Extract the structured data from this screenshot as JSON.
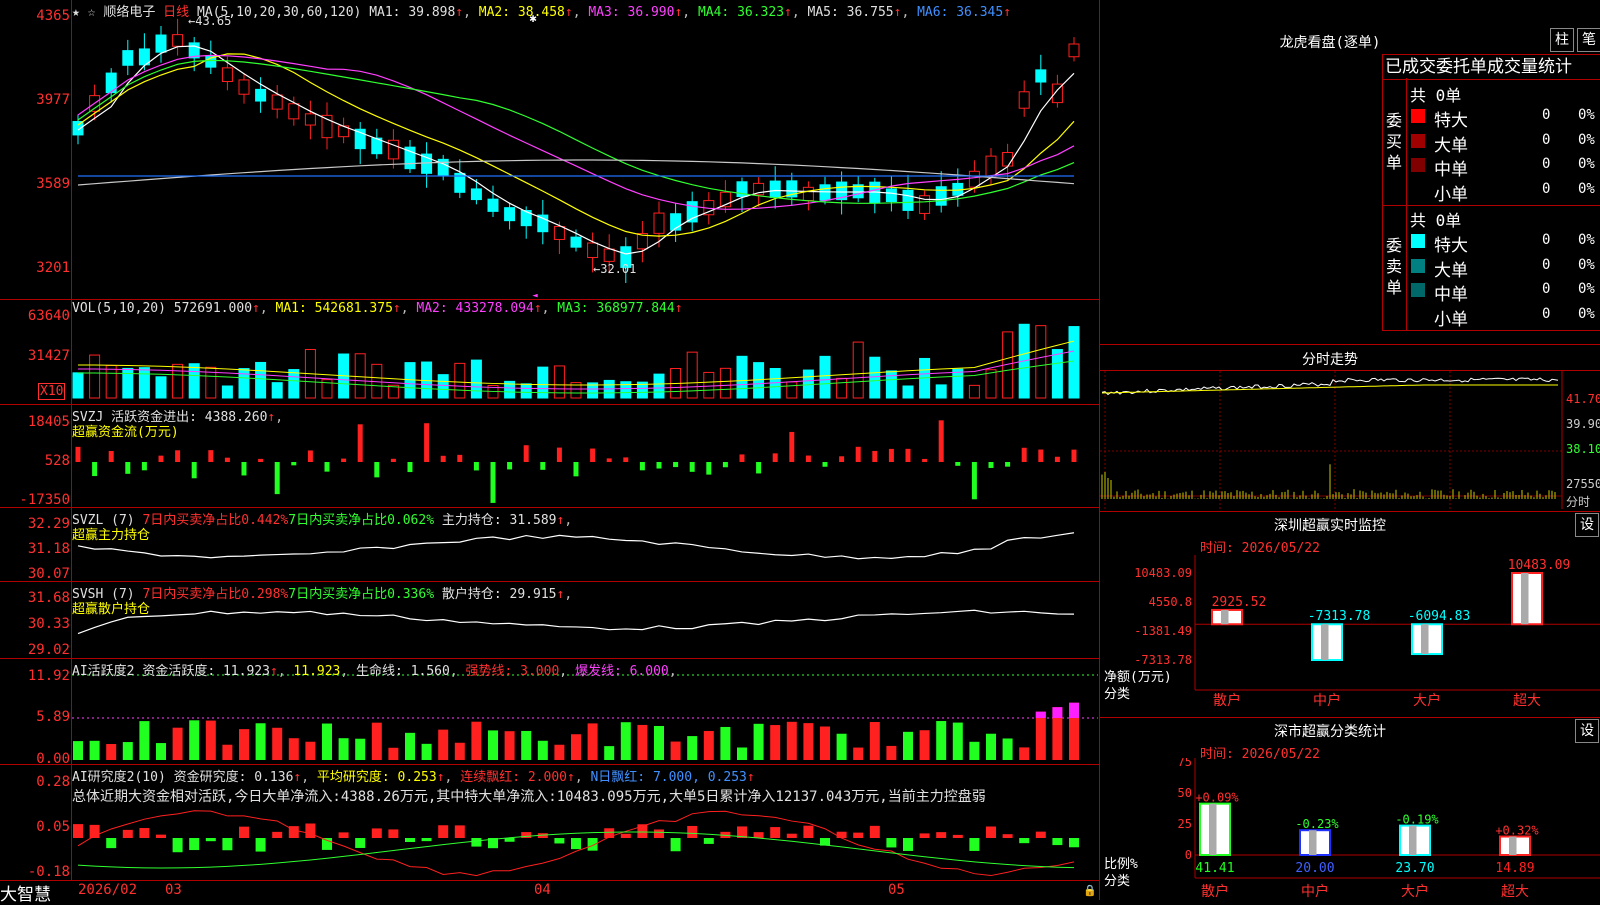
{
  "stock_name": "顺络电子",
  "period_label": "日线",
  "price_panel": {
    "ma_params": "MA(5,10,20,30,60,120)",
    "ma1": "MA1: 39.898",
    "ma2": "MA2: 38.458",
    "ma3": "MA3: 36.990",
    "ma4": "MA4: 36.323",
    "ma5": "MA5: 36.755",
    "ma6": "MA6: 36.345",
    "high_mark": "43.65",
    "low_mark": "32.01",
    "axis": [
      "4365",
      "3977",
      "3589",
      "3201"
    ]
  },
  "vol_panel": {
    "label": "VOL(5,10,20)",
    "value": "572691.000",
    "ma1": "MA1: 542681.375",
    "ma2": "MA2: 433278.094",
    "ma3": "MA3: 368977.844",
    "axis": [
      "63640",
      "31427"
    ],
    "unit": "X10"
  },
  "svzj_panel": {
    "label": "SVZJ",
    "title": "活跃资金进出: 4388.260",
    "subtitle": "超赢资金流(万元)",
    "axis": [
      "18405",
      "528",
      "-17350"
    ]
  },
  "svzl_panel": {
    "label": "SVZL (7)",
    "t1": "7日内买卖净占比0.442%",
    "t2": "7日内买卖净占比0.062%",
    "t3": "主力持仓: 31.589",
    "subtitle": "超赢主力持仓",
    "axis": [
      "32.29",
      "31.18",
      "30.07"
    ]
  },
  "svsh_panel": {
    "label": "SVSH (7)",
    "t1": "7日内买卖净占比0.298%",
    "t2": "7日内买卖净占比0.336%",
    "t3": "散户持仓: 29.915",
    "subtitle": "超赢散户持仓",
    "axis": [
      "31.68",
      "30.33",
      "29.02"
    ]
  },
  "ai_active_panel": {
    "label": "AI活跃度2",
    "t1": "资金活跃度: 11.923",
    "t2": "11.923",
    "t3": "生命线: 1.560",
    "t4": "强势线: 3.000",
    "t5": "爆发线: 6.000",
    "axis": [
      "11.92",
      "5.89",
      "0.00"
    ]
  },
  "ai_research_panel": {
    "label": "AI研究度2(10)",
    "t1": "资金研究度: 0.136",
    "t2": "平均研究度: 0.253",
    "t3": "连续飘红: 2.000",
    "t4": "N日飘红: 7.000, 0.253",
    "summary": "总体近期大资金相对活跃,今日大单净流入:4388.26万元,其中特大单净流入:10483.095万元,大单5日累计净入12137.043万元,当前主力控盘弱",
    "axis": [
      "0.28",
      "0.05",
      "-0.18"
    ]
  },
  "bottom_axis": {
    "brand": "大智慧",
    "labels": [
      "2026/02",
      "03",
      "04",
      "05"
    ]
  },
  "dragon_tiger": {
    "title": "龙虎看盘(逐单)",
    "btn1": "柱",
    "btn2": "笔",
    "header": "已成交委托单成交量统计",
    "buy_label": "委买单",
    "sell_label": "委卖单",
    "buy_total": "共 0单",
    "sell_total": "共 0单",
    "rows": [
      {
        "name": "特大",
        "count": "0",
        "pct": "0%"
      },
      {
        "name": "大单",
        "count": "0",
        "pct": "0%"
      },
      {
        "name": "中单",
        "count": "0",
        "pct": "0%"
      },
      {
        "name": "小单",
        "count": "0",
        "pct": "0%"
      }
    ],
    "buy_colors": [
      "#ff0000",
      "#a00000",
      "#800000",
      "#000000"
    ],
    "sell_colors": [
      "#00ffff",
      "#008080",
      "#006868",
      "#000000"
    ]
  },
  "intraday": {
    "title": "分时走势",
    "axis": [
      "41.70",
      "39.90",
      "38.10",
      "27550"
    ],
    "unit": "分时"
  },
  "sz_monitor": {
    "title": "深圳超赢实时监控",
    "btn": "设",
    "time": "时间: 2026/05/22",
    "axis": [
      "10483.09",
      "4550.8",
      "-1381.49",
      "-7313.78"
    ],
    "bar_labels": [
      "2925.52",
      "-7313.78",
      "-6094.83",
      "10483.09"
    ],
    "ylabel": "净额(万元)",
    "xlabel": "分类",
    "categories": [
      "散户",
      "中户",
      "大户",
      "超大"
    ]
  },
  "sz_class": {
    "title": "深市超赢分类统计",
    "btn": "设",
    "time": "时间: 2026/05/22",
    "axis": [
      "75",
      "50",
      "25",
      "0"
    ],
    "change_labels": [
      "+0.09%",
      "-0.23%",
      "-0.19%",
      "+0.32%"
    ],
    "value_labels": [
      "41.41",
      "20.00",
      "23.70",
      "14.89"
    ],
    "ylabel": "比例%",
    "xlabel": "分类",
    "categories": [
      "散户",
      "中户",
      "大户",
      "超大"
    ]
  },
  "chart_data": [
    {
      "type": "bar",
      "title": "深圳超赢实时监控",
      "categories": [
        "散户",
        "中户",
        "大户",
        "超大"
      ],
      "values": [
        2925.52,
        -7313.78,
        -6094.83,
        10483.09
      ],
      "ylabel": "净额(万元)",
      "xlabel": "分类",
      "ylim": [
        -7313.78,
        10483.09
      ]
    },
    {
      "type": "bar",
      "title": "深市超赢分类统计",
      "categories": [
        "散户",
        "中户",
        "大户",
        "超大"
      ],
      "values": [
        41.41,
        20.0,
        23.7,
        14.89
      ],
      "ylabel": "比例%",
      "xlabel": "分类",
      "ylim": [
        0,
        75
      ]
    }
  ]
}
